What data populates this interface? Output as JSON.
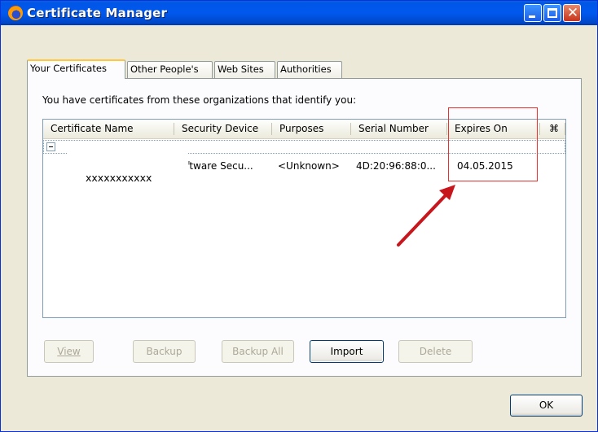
{
  "window": {
    "title": "Certificate Manager",
    "controls": {
      "close_glyph": "✕"
    }
  },
  "tabs": [
    {
      "label": "Your Certificates",
      "active": true
    },
    {
      "label": "Other People's",
      "active": false
    },
    {
      "label": "Web Sites",
      "active": false
    },
    {
      "label": "Authorities",
      "active": false
    }
  ],
  "panel": {
    "intro_text": "You have certificates from these organizations that identify you:"
  },
  "table": {
    "columns": [
      "Certificate Name",
      "Security Device",
      "Purposes",
      "Serial Number",
      "Expires On"
    ],
    "column_picker_glyph": "⌘",
    "rows": [
      {
        "name": "xxxxxxxxxxx",
        "security_device": "oftware Secu...",
        "purposes": "<Unknown>",
        "serial_number": "4D:20:96:88:0...",
        "expires_on": "04.05.2015"
      }
    ]
  },
  "buttons": {
    "view": "View",
    "backup": "Backup",
    "backup_all": "Backup All",
    "import": "Import",
    "delete": "Delete",
    "ok": "OK"
  },
  "colors": {
    "titlebar": "#0058ee",
    "annotation": "#c8161d"
  }
}
